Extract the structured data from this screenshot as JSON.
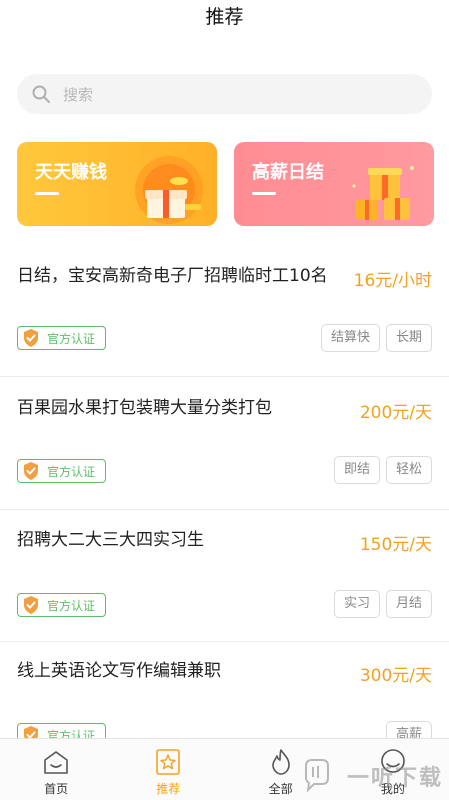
{
  "header": {
    "title": "推荐"
  },
  "search": {
    "placeholder": "搜索",
    "icon": "search-icon"
  },
  "banners": [
    {
      "title": "天天赚钱",
      "color": "#ffbd32",
      "icon": "gift-box-icon"
    },
    {
      "title": "高薪日结",
      "color": "#ff8f96",
      "icon": "gift-boxes-icon"
    }
  ],
  "jobs": [
    {
      "title": "日结，宝安高新奇电子厂招聘临时工10名",
      "salary": "16元/小时",
      "badge": "官方认证",
      "tags": [
        "结算快",
        "长期"
      ]
    },
    {
      "title": "百果园水果打包装聘大量分类打包",
      "salary": "200元/天",
      "badge": "官方认证",
      "tags": [
        "即结",
        "轻松"
      ]
    },
    {
      "title": "招聘大二大三大四实习生",
      "salary": "150元/天",
      "badge": "官方认证",
      "tags": [
        "实习",
        "月结"
      ]
    },
    {
      "title": "线上英语论文写作编辑兼职",
      "salary": "300元/天",
      "badge": "官方认证",
      "tags": [
        "高薪"
      ]
    }
  ],
  "tabbar": {
    "items": [
      {
        "label": "首页",
        "icon": "home-icon"
      },
      {
        "label": "推荐",
        "icon": "star-icon",
        "active": true
      },
      {
        "label": "全部",
        "icon": "fire-icon"
      },
      {
        "label": "我的",
        "icon": "profile-icon"
      }
    ]
  },
  "watermark": {
    "text": "一听下载"
  },
  "colors": {
    "accent": "#f2a223",
    "verified": "#5cbf68"
  }
}
